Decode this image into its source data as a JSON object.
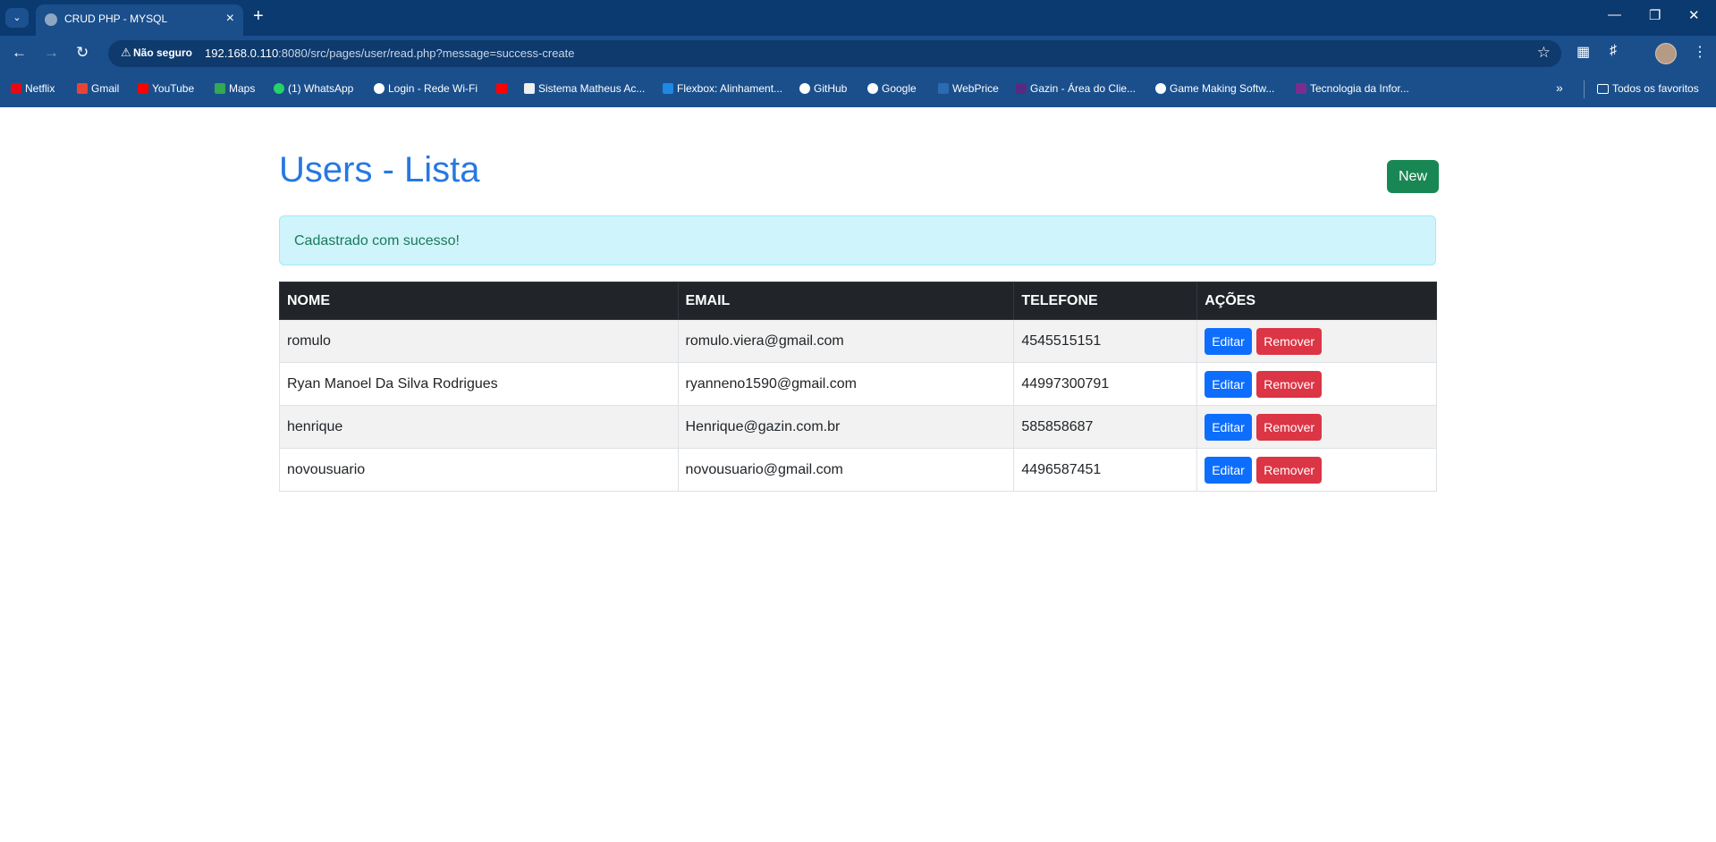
{
  "browser": {
    "tab_title": "CRUD PHP - MYSQL",
    "security_label": "Não seguro",
    "url_host": "192.168.0.110",
    "url_rest": ":8080/src/pages/user/read.php?message=success-create",
    "bookmarks": [
      {
        "label": "Netflix",
        "icon": "netflix-icon",
        "color": "#e50914"
      },
      {
        "label": "Gmail",
        "icon": "gmail-icon",
        "color": "#ea4335"
      },
      {
        "label": "YouTube",
        "icon": "youtube-icon",
        "color": "#ff0000"
      },
      {
        "label": "Maps",
        "icon": "maps-icon",
        "color": "#34a853"
      },
      {
        "label": "(1) WhatsApp",
        "icon": "whatsapp-icon",
        "color": "#25d366"
      },
      {
        "label": "Login - Rede Wi-Fi",
        "icon": "globe-icon",
        "color": "#ffffff"
      },
      {
        "label": "",
        "icon": "youtube-icon",
        "color": "#ff0000"
      },
      {
        "label": "Sistema Matheus Ac...",
        "icon": "sistema-icon",
        "color": "#f0f0f0"
      },
      {
        "label": "Flexbox: Alinhament...",
        "icon": "flexbox-icon",
        "color": "#1e88e5"
      },
      {
        "label": "GitHub",
        "icon": "github-icon",
        "color": "#ffffff"
      },
      {
        "label": "Google",
        "icon": "google-icon",
        "color": "#ffffff"
      },
      {
        "label": "WebPrice",
        "icon": "webprice-icon",
        "color": "#2b6cb0"
      },
      {
        "label": "Gazin - Área do Clie...",
        "icon": "gazin-icon",
        "color": "#5a2a82"
      },
      {
        "label": "Game Making Softw...",
        "icon": "gamemaker-icon",
        "color": "#ffffff"
      },
      {
        "label": "Tecnologia da Infor...",
        "icon": "tecnologia-icon",
        "color": "#7b2d8e"
      }
    ],
    "all_bookmarks_label": "Todos os favoritos"
  },
  "page": {
    "title": "Users - Lista",
    "new_button": "New",
    "alert_message": "Cadastrado com sucesso!",
    "table": {
      "headers": [
        "NOME",
        "EMAIL",
        "TELEFONE",
        "AÇÕES"
      ],
      "edit_label": "Editar",
      "remove_label": "Remover",
      "rows": [
        {
          "nome": "romulo",
          "email": "romulo.viera@gmail.com",
          "telefone": "4545515151"
        },
        {
          "nome": "Ryan Manoel Da Silva Rodrigues",
          "email": "ryanneno1590@gmail.com",
          "telefone": "44997300791"
        },
        {
          "nome": "henrique",
          "email": "Henrique@gazin.com.br",
          "telefone": "585858687"
        },
        {
          "nome": "novousuario",
          "email": "novousuario@gmail.com",
          "telefone": "4496587451"
        }
      ]
    }
  },
  "colors": {
    "title": "#2678e2",
    "new_button": "#198754",
    "alert_bg": "#cff4fc",
    "edit_button": "#0d6efd",
    "remove_button": "#dc3545",
    "table_header": "#212529",
    "browser_frame": "#1a4f8c"
  }
}
